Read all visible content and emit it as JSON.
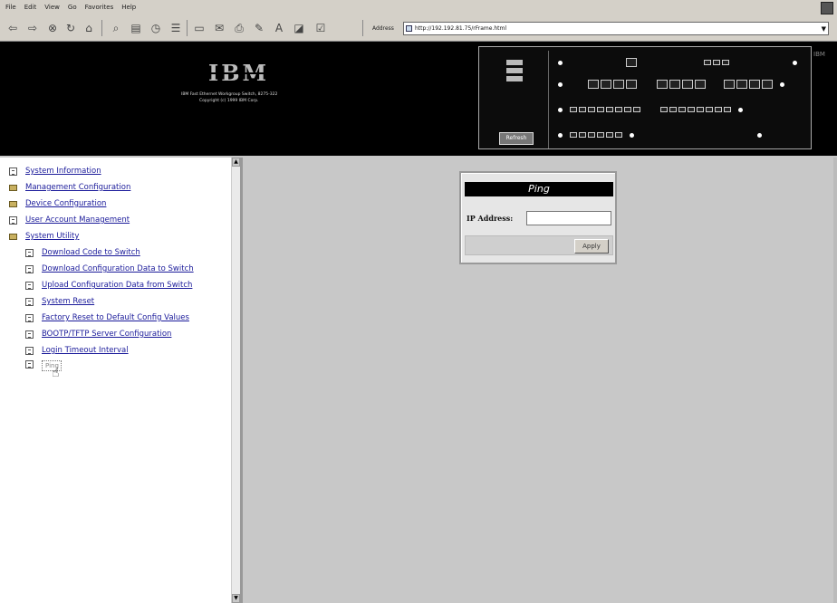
{
  "menu": [
    "File",
    "Edit",
    "View",
    "Go",
    "Favorites",
    "Help"
  ],
  "address": {
    "label": "Address",
    "url": "http://192.192.81.75/rFrame.html"
  },
  "banner": {
    "logo": "IBM",
    "line1": "IBM Fast Ethernet Workgroup Switch, 8275-322",
    "line2": "Copyright (c) 1999 IBM Corp.",
    "refresh": "Refresh",
    "corner_logo": "IBM"
  },
  "nav": {
    "items": [
      {
        "label": "System Information",
        "icon": "doc-icon"
      },
      {
        "label": "Management Configuration",
        "icon": "folder-icon"
      },
      {
        "label": "Device Configuration",
        "icon": "folder-icon"
      },
      {
        "label": "User Account Management",
        "icon": "doc-icon"
      },
      {
        "label": "System Utility",
        "icon": "folder-open-icon"
      }
    ],
    "sub_items": [
      "Download Code to Switch",
      "Download Configuration Data to Switch",
      "Upload Configuration Data from Switch",
      "System Reset",
      "Factory Reset to Default Config Values",
      "BOOTP/TFTP Server Configuration",
      "Login Timeout Interval"
    ],
    "ping": "Ping"
  },
  "ping_form": {
    "title": "Ping",
    "ip_label": "IP Address:",
    "ip_value": "",
    "apply": "Apply"
  }
}
